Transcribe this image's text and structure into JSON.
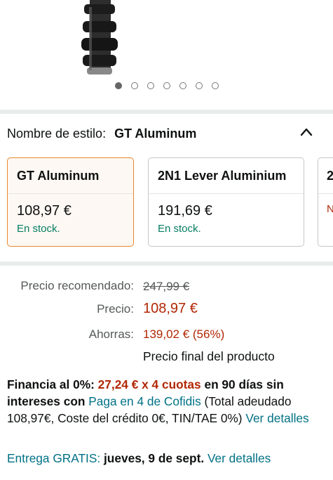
{
  "carousel": {
    "dots": 7,
    "active_index": 0
  },
  "style_selector": {
    "label": "Nombre de estilo:",
    "selected": "GT Aluminum",
    "options": [
      {
        "name": "GT Aluminum",
        "price": "108,97 €",
        "stock": "En stock."
      },
      {
        "name": "2N1 Lever Aluminium",
        "price": "191,69 €",
        "stock": "En stock."
      },
      {
        "name": "2",
        "price": "",
        "stock": "N"
      }
    ]
  },
  "pricing": {
    "recommended_label": "Precio recomendado:",
    "recommended_value": "247,99 €",
    "price_label": "Precio:",
    "price_value": "108,97 €",
    "savings_label": "Ahorras:",
    "savings_value": "139,02 € (56%)",
    "final_note": "Precio final del producto"
  },
  "financing": {
    "lead": "Financia al 0%:",
    "installments": "27,24 € x 4 cuotas",
    "term": "en 90 días sin intereses",
    "with": "con",
    "provider_link": "Paga en 4 de Cofidis",
    "details_text": "(Total adeudado 108,97€, Coste del crédito 0€, TIN/TAE 0%)",
    "more_link": "Ver detalles"
  },
  "delivery": {
    "label": "Entrega GRATIS:",
    "date": "jueves, 9 de sept.",
    "more_link": "Ver detalles"
  },
  "colors": {
    "accent_orange": "#e8872f",
    "price_red": "#b12704",
    "stock_green": "#067d62",
    "link_teal": "#007185"
  }
}
